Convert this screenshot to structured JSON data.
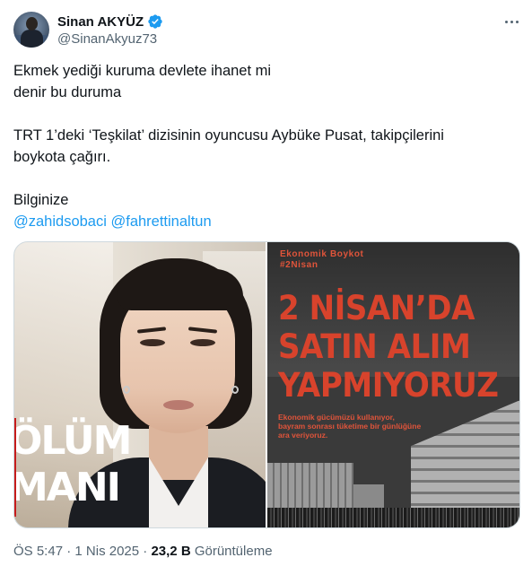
{
  "author": {
    "display_name": "Sinan AKYÜZ",
    "handle": "@SinanAkyuz73",
    "verified": true
  },
  "tweet": {
    "lines": [
      "Ekmek yediği kuruma devlete ihanet mi",
      "denir bu duruma",
      "",
      "TRT 1’deki ‘Teşkilat’ dizisinin oyuncusu Aybüke Pusat, takipçilerini",
      "boykota çağırı.",
      "",
      "Bilginize"
    ],
    "mentions": [
      "@zahidsobaci",
      "@fahrettinaltun"
    ]
  },
  "media": {
    "left_image": {
      "overlay_lines": [
        "ÖLÜM",
        "MANI"
      ]
    },
    "right_image": {
      "kicker_lines": [
        "Ekonomik Boykot",
        "#2Nisan"
      ],
      "headline_lines": [
        "2 NİSAN’DA",
        "SATIN ALIM",
        "YAPMIYORUZ"
      ],
      "subtext_lines": [
        "Ekonomik gücümüzü kullanıyor,",
        "bayram sonrası tüketime bir günlüğüne",
        "ara veriyoruz."
      ]
    }
  },
  "meta": {
    "time": "ÖS 5:47",
    "separator1": "·",
    "date": "1 Nis 2025",
    "separator2": "·",
    "views_count": "23,2 B",
    "views_label": "Görüntüleme"
  },
  "colors": {
    "link": "#1d9bf0",
    "secondary_text": "#536471",
    "verified": "#1d9bf0",
    "headline_red": "#d8432c"
  }
}
